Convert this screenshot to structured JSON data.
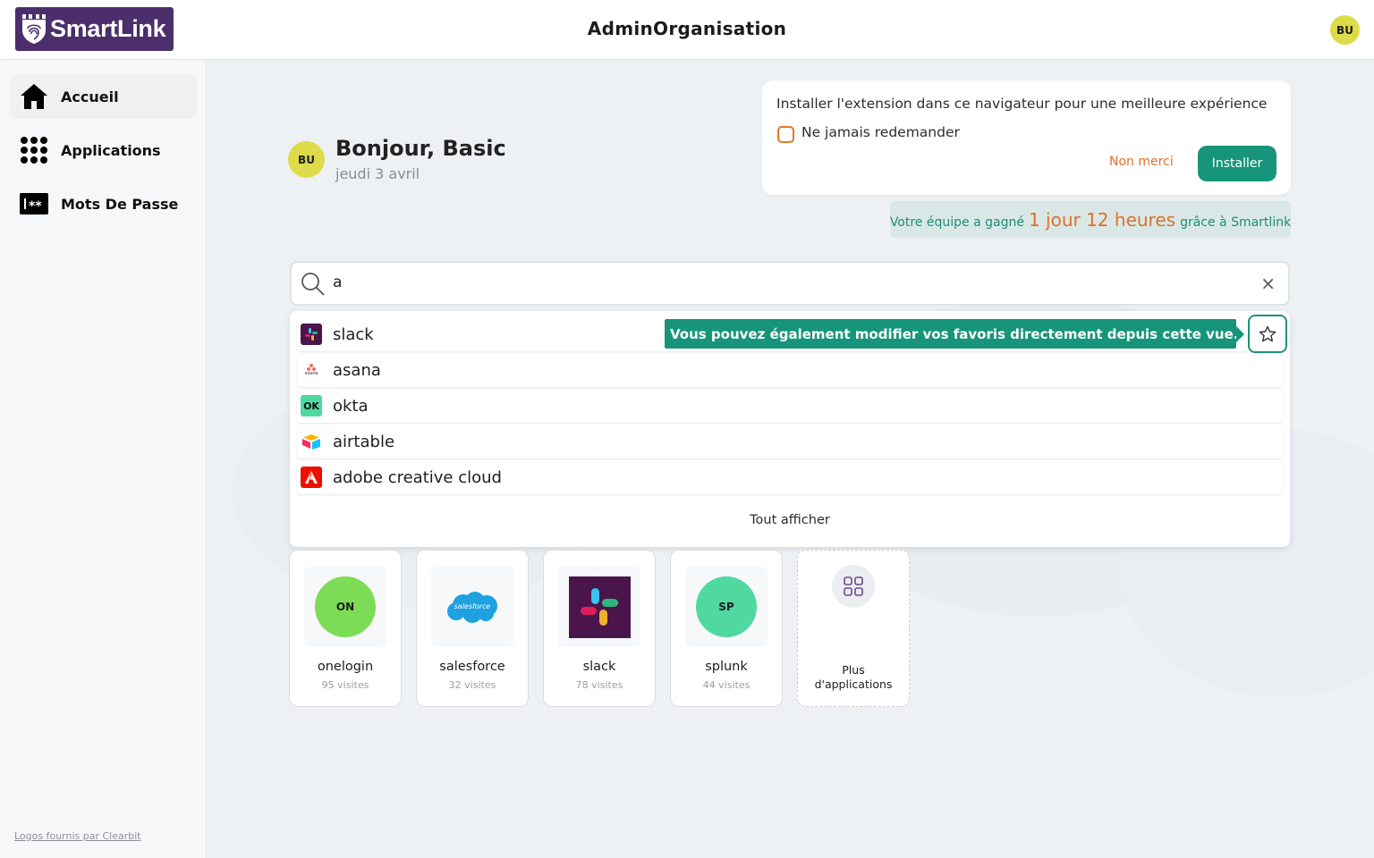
{
  "header": {
    "logo_text": "SmartLink",
    "org_title": "AdminOrganisation",
    "avatar_initials": "BU"
  },
  "sidebar": {
    "items": [
      {
        "label": "Accueil",
        "icon": "home-icon",
        "active": true
      },
      {
        "label": "Applications",
        "icon": "apps-grid-icon",
        "active": false
      },
      {
        "label": "Mots De Passe",
        "icon": "password-icon",
        "active": false
      }
    ],
    "footer_link": "Logos fournis par Clearbit"
  },
  "greeting": {
    "avatar_initials": "BU",
    "title": "Bonjour, Basic",
    "date": "jeudi 3 avril"
  },
  "extension_prompt": {
    "text": "Installer l'extension dans ce navigateur pour une meilleure expérience",
    "checkbox_label": "Ne jamais redemander",
    "checkbox_checked": false,
    "decline_label": "Non merci",
    "install_label": "Installer"
  },
  "time_saved": {
    "prefix": "Votre équipe a gagné",
    "amount": "1 jour 12 heures",
    "suffix": "grâce à Smartlink"
  },
  "search": {
    "value": "a",
    "clear_icon": "close-icon"
  },
  "results": [
    {
      "name": "slack",
      "logo": "slack-logo"
    },
    {
      "name": "asana",
      "logo": "asana-logo",
      "logo_text": "asana"
    },
    {
      "name": "okta",
      "logo": "okta-logo",
      "logo_text": "OK"
    },
    {
      "name": "airtable",
      "logo": "airtable-logo"
    },
    {
      "name": "adobe creative cloud",
      "logo": "adobe-logo"
    }
  ],
  "show_all_label": "Tout afficher",
  "tooltip": "Vous pouvez également modifier vos favoris directement depuis cette vue.",
  "favorites": [
    {
      "name": "onelogin",
      "visits": "95 visites",
      "badge": "ON",
      "color": "#7ddc55"
    },
    {
      "name": "salesforce",
      "visits": "32 visites",
      "badge": "salesforce",
      "color": "#1ea1e0"
    },
    {
      "name": "slack",
      "visits": "78 visites",
      "badge": "",
      "color": "#4a154b"
    },
    {
      "name": "splunk",
      "visits": "44 visites",
      "badge": "SP",
      "color": "#4fd8a0"
    }
  ],
  "more_apps": {
    "line1": "Plus",
    "line2": "d'applications"
  },
  "colors": {
    "brand_purple": "#4b2e6b",
    "accent_green": "#17957a",
    "accent_orange": "#e0702a",
    "avatar_yellow": "#dedb4a"
  }
}
